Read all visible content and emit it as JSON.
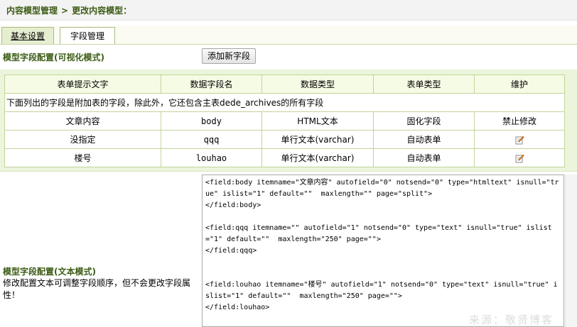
{
  "breadcrumb": {
    "root": "内容模型管理",
    "separator": ">",
    "current": "更改内容模型："
  },
  "tabs": [
    {
      "label": "基本设置"
    },
    {
      "label": "字段管理"
    }
  ],
  "visual_section": {
    "title": "模型字段配置(可视化模式)",
    "add_button": "添加新字段"
  },
  "table": {
    "headers": [
      "表单提示文字",
      "数据字段名",
      "数据类型",
      "表单类型",
      "维护"
    ],
    "note": "下面列出的字段是附加表的字段，除此外，它还包含主表dede_archives的所有字段",
    "rows": [
      {
        "label": "文章内容",
        "field": "body",
        "type": "HTML文本",
        "form": "固化字段",
        "action": "禁止修改",
        "editable": false
      },
      {
        "label": "没指定",
        "field": "qqq",
        "type": "单行文本(varchar)",
        "form": "自动表单",
        "action": "edit-icon",
        "editable": true
      },
      {
        "label": "楼号",
        "field": "louhao",
        "type": "单行文本(varchar)",
        "form": "自动表单",
        "action": "edit-icon",
        "editable": true
      }
    ]
  },
  "text_section": {
    "title": "模型字段配置(文本模式)",
    "desc": "修改配置文本可调整字段顺序，但不会更改字段属性！",
    "config_text": "<field:body itemname=\"文章内容\" autofield=\"0\" notsend=\"0\" type=\"htmltext\" isnull=\"true\" islist=\"1\" default=\"\"  maxlength=\"\" page=\"split\">\n</field:body>\n\n<field:qqq itemname=\"\" autofield=\"1\" notsend=\"0\" type=\"text\" isnull=\"true\" islist=\"1\" default=\"\"  maxlength=\"250\" page=\"\">\n</field:qqq>\n\n\n<field:louhao itemname=\"楼号\" autofield=\"1\" notsend=\"0\" type=\"text\" isnull=\"true\" islist=\"1\" default=\"\"  maxlength=\"250\" page=\"\">\n</field:louhao>"
  },
  "watermark": "来源：敬贤博客",
  "colors": {
    "accent": "#3c5b14",
    "table_bg": "#ecf5dc",
    "border": "#c2d49a"
  }
}
